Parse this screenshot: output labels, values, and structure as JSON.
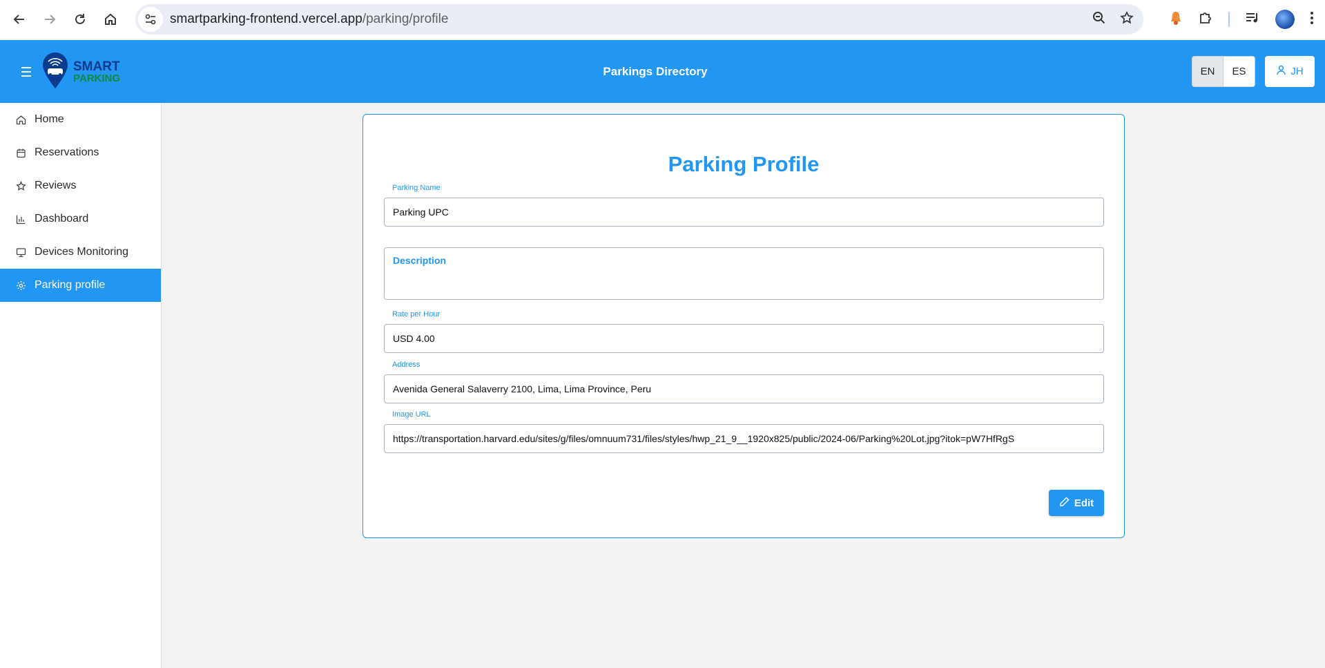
{
  "browser": {
    "url_host": "smartparking-frontend.vercel.app",
    "url_path": "/parking/profile"
  },
  "header": {
    "logo_line1": "SMART",
    "logo_line2": "PARKING",
    "title": "Parkings Directory",
    "lang_en": "EN",
    "lang_es": "ES",
    "user_initials": "JH",
    "bg_color": "#2196f3"
  },
  "sidebar": {
    "items": [
      {
        "label": "Home",
        "icon": "home-icon"
      },
      {
        "label": "Reservations",
        "icon": "calendar-icon"
      },
      {
        "label": "Reviews",
        "icon": "star-icon"
      },
      {
        "label": "Dashboard",
        "icon": "bar-chart-icon"
      },
      {
        "label": "Devices Monitoring",
        "icon": "monitor-icon"
      },
      {
        "label": "Parking profile",
        "icon": "gear-icon"
      }
    ],
    "active_index": 5
  },
  "profile": {
    "title": "Parking Profile",
    "parking_name_label": "Parking Name",
    "parking_name_value": "Parking UPC",
    "description_label": "Description",
    "rate_label": "Rate per Hour",
    "rate_value": "USD 4.00",
    "address_label": "Address",
    "address_value": "Avenida General Salaverry 2100, Lima, Lima Province, Peru",
    "image_url_label": "Image URL",
    "image_url_value": "https://transportation.harvard.edu/sites/g/files/omnuum731/files/styles/hwp_21_9__1920x825/public/2024-06/Parking%20Lot.jpg?itok=pW7HfRgS",
    "edit_label": "Edit"
  }
}
